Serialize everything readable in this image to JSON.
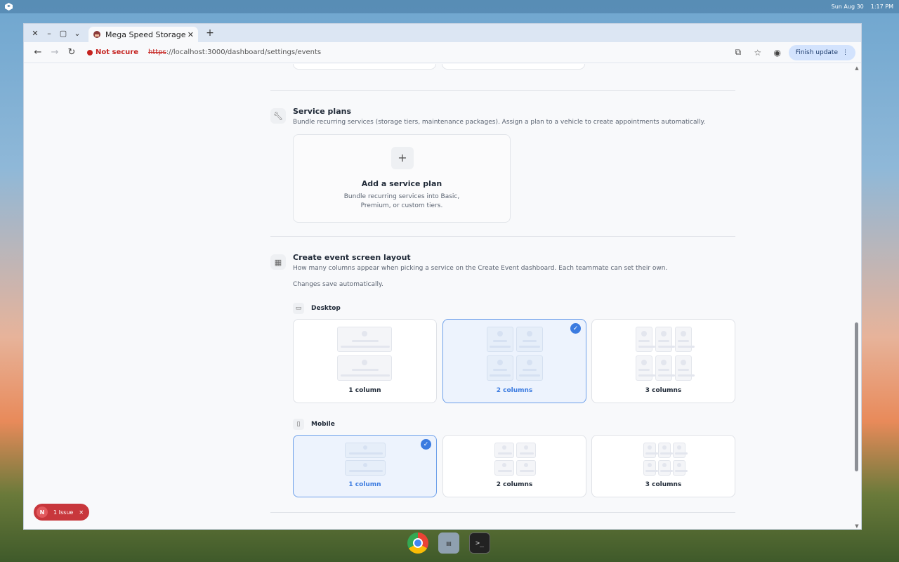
{
  "system_bar": {
    "date": "Sun Aug 30",
    "time": "1:17 PM"
  },
  "browser": {
    "tab_title": "Mega Speed Storage",
    "security_label": "Not secure",
    "url_scheme": "https",
    "url_rest": "://localhost:3000/dashboard/settings/events",
    "finish_update_label": "Finish update"
  },
  "service_plans": {
    "title": "Service plans",
    "description": "Bundle recurring services (storage tiers, maintenance packages). Assign a plan to a vehicle to create appointments automatically.",
    "add_card_title": "Add a service plan",
    "add_card_line1": "Bundle recurring services into Basic,",
    "add_card_line2": "Premium, or custom tiers."
  },
  "layout_section": {
    "title": "Create event screen layout",
    "description": "How many columns appear when picking a service on the Create Event dashboard. Each teammate can set their own.",
    "autosave_note": "Changes save automatically.",
    "desktop_label": "Desktop",
    "mobile_label": "Mobile",
    "desktop_options": [
      {
        "label": "1 column",
        "selected": false
      },
      {
        "label": "2 columns",
        "selected": true
      },
      {
        "label": "3 columns",
        "selected": false
      }
    ],
    "mobile_options": [
      {
        "label": "1 column",
        "selected": true
      },
      {
        "label": "2 columns",
        "selected": false
      },
      {
        "label": "3 columns",
        "selected": false
      }
    ]
  },
  "issue_badge": {
    "letter": "N",
    "label": "1 Issue"
  },
  "colors": {
    "accent": "#3b7be0",
    "danger": "#c8373c",
    "selected_bg": "#edf3fd"
  }
}
